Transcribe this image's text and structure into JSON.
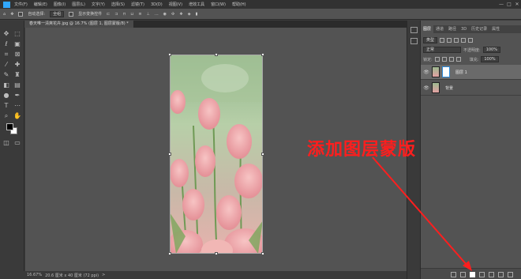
{
  "app": {
    "name": "Photoshop"
  },
  "menubar": {
    "items": [
      "文件(F)",
      "编辑(E)",
      "图像(I)",
      "图层(L)",
      "文字(Y)",
      "选择(S)",
      "滤镜(T)",
      "3D(D)",
      "视图(V)",
      "增效工具",
      "窗口(W)",
      "帮助(H)"
    ],
    "window_controls": [
      "—",
      "□",
      "✕"
    ]
  },
  "options_bar": {
    "auto_select_label": "自动选择:",
    "auto_select_value": "全组",
    "show_transform_label": "显示变换控件",
    "dots": "..."
  },
  "document_tab": {
    "title": "春天唯一清爽花卉.jpg @ 16.7% (图层 1, 图层蒙版/8) *"
  },
  "status_bar": {
    "zoom": "16.67%",
    "info": "20.6 厘米 x 40 厘米 (72 ppi)",
    "arrow": ">"
  },
  "layers_panel": {
    "tabs": [
      "图层",
      "通道",
      "路径",
      "3D",
      "历史记录",
      "属性"
    ],
    "active_tab": "图层",
    "filter_label": "类型",
    "blend_mode": "正常",
    "opacity_label": "不透明度:",
    "opacity_value": "100%",
    "lock_label": "锁定:",
    "fill_label": "填充:",
    "fill_value": "100%",
    "layers": [
      {
        "name": "图层 1",
        "has_mask": true,
        "selected": true
      },
      {
        "name": "背景",
        "has_mask": false,
        "selected": false
      }
    ]
  },
  "annotation": {
    "text": "添加图层蒙版",
    "color": "#ff1e1e"
  },
  "colors": {
    "app_bg": "#535353",
    "accent": "#31a8ff",
    "annotation": "#ff1e1e"
  }
}
